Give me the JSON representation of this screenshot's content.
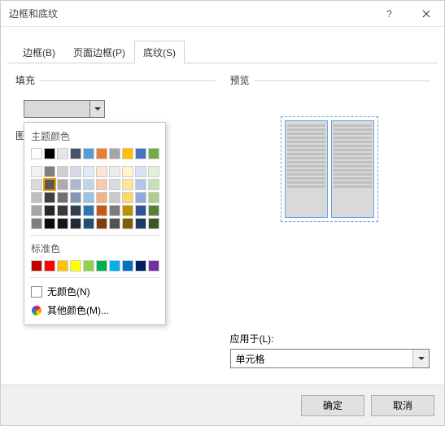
{
  "title": "边框和底纹",
  "tabs": {
    "borders": "边框(B)",
    "page": "页面边框(P)",
    "shading": "底纹(S)"
  },
  "left": {
    "fill_label": "填充",
    "pattern_stub": "图"
  },
  "popup": {
    "theme_label": "主题颜色",
    "standard_label": "标准色",
    "no_color": "无颜色(N)",
    "more": "其他颜色(M)...",
    "theme_row1": [
      "#ffffff",
      "#000000",
      "#e7e6e6",
      "#44546a",
      "#5b9bd5",
      "#ed7d31",
      "#a5a5a5",
      "#ffc000",
      "#4472c4",
      "#70ad47"
    ],
    "theme_shades": [
      [
        "#f2f2f2",
        "#7f7f7f",
        "#d0cece",
        "#d6dce5",
        "#deebf7",
        "#fbe5d6",
        "#ededed",
        "#fff2cc",
        "#d9e2f3",
        "#e2efda"
      ],
      [
        "#d9d9d9",
        "#595959",
        "#aeabab",
        "#adb9ca",
        "#bdd7ee",
        "#f8cbad",
        "#dbdbdb",
        "#ffe699",
        "#b4c6e7",
        "#c5e0b4"
      ],
      [
        "#bfbfbf",
        "#3f3f3f",
        "#757070",
        "#8497b0",
        "#9cc3e6",
        "#f4b183",
        "#c9c9c9",
        "#ffd966",
        "#8eaadb",
        "#a9d18e"
      ],
      [
        "#a5a5a5",
        "#262626",
        "#3a3838",
        "#323f4f",
        "#2e75b6",
        "#c55a11",
        "#7b7b7b",
        "#bf9000",
        "#2f5597",
        "#548235"
      ],
      [
        "#7f7f7f",
        "#0c0c0c",
        "#171616",
        "#222a35",
        "#1f4e79",
        "#843c0c",
        "#525252",
        "#7f6000",
        "#1f3864",
        "#385723"
      ]
    ],
    "theme_selected": [
      1,
      1
    ],
    "standard": [
      "#c00000",
      "#ff0000",
      "#ffc000",
      "#ffff00",
      "#92d050",
      "#00b050",
      "#00b0f0",
      "#0070c0",
      "#002060",
      "#7030a0"
    ]
  },
  "right": {
    "preview_label": "预览",
    "apply_label": "应用于(L):",
    "apply_value": "单元格"
  },
  "footer": {
    "ok": "确定",
    "cancel": "取消"
  }
}
